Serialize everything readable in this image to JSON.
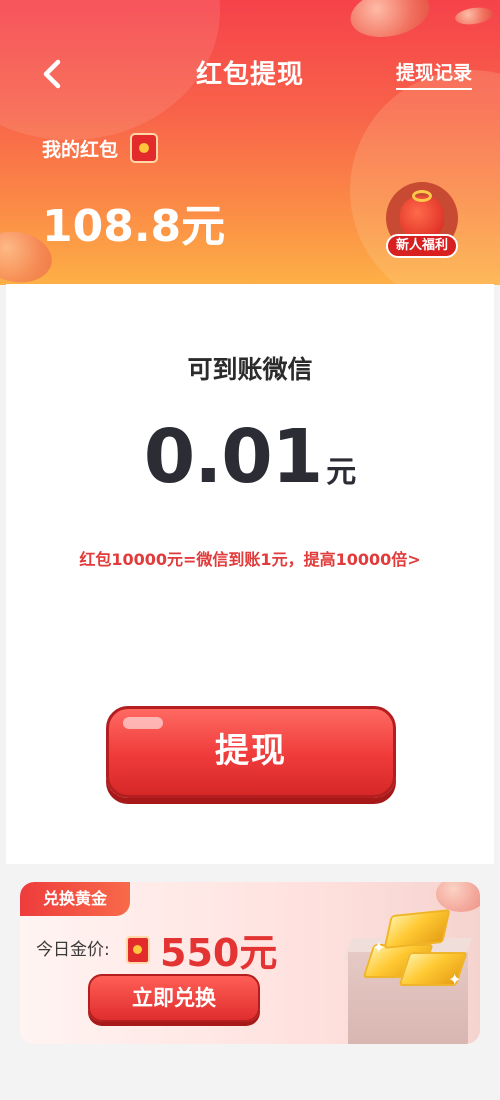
{
  "header": {
    "title": "红包提现",
    "records_link": "提现记录",
    "my_redpacket_label": "我的红包",
    "balance": "108.8元",
    "newbie_badge": "新人福利"
  },
  "withdraw": {
    "arrive_label": "可到账微信",
    "amount": "0.01",
    "amount_unit": "元",
    "promo_text": "红包10000元=微信到账1元，提高10000倍>",
    "button_label": "提现"
  },
  "gold_exchange": {
    "tag": "兑换黄金",
    "price_label": "今日金价:",
    "price_value": "550元",
    "button_label": "立即兑换"
  },
  "icons": {
    "back": "chevron-left-icon",
    "red_packet": "red-packet-icon",
    "gift_bag": "gift-bag-icon",
    "gold_bars": "gold-bars-icon"
  },
  "colors": {
    "header_top": "#f6424a",
    "header_bottom": "#fdb046",
    "accent_red": "#e33333",
    "amount_text": "#2c2c35"
  }
}
